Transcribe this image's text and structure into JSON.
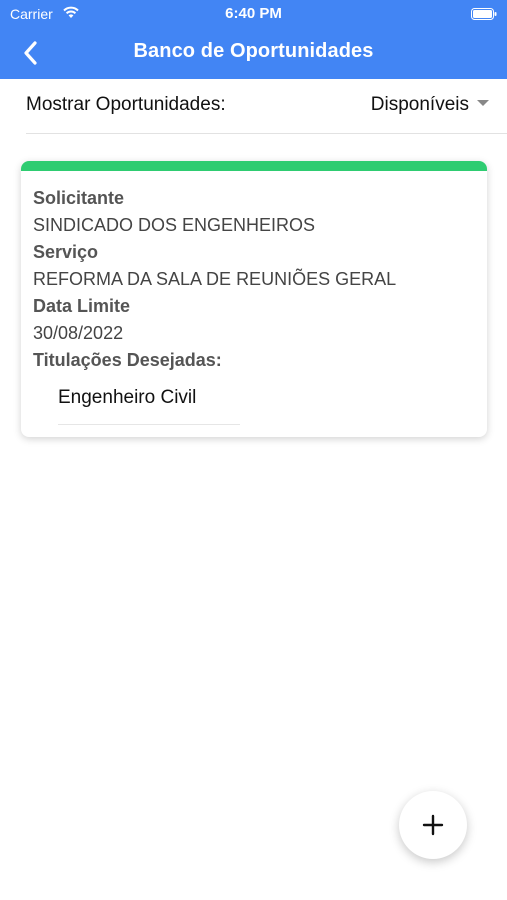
{
  "status_bar": {
    "carrier": "Carrier",
    "time": "6:40 PM"
  },
  "header": {
    "title": "Banco de Oportunidades",
    "background_color": "#4285f4",
    "back_icon": "chevron-left-icon"
  },
  "filter": {
    "label": "Mostrar Oportunidades:",
    "selected": "Disponíveis"
  },
  "card": {
    "accent_color": "#2ecc71",
    "solicitante_label": "Solicitante",
    "solicitante_value": "SINDICADO DOS ENGENHEIROS",
    "servico_label": "Serviço",
    "servico_value": "REFORMA DA SALA DE REUNIÕES GERAL",
    "data_limite_label": "Data Limite",
    "data_limite_value": "30/08/2022",
    "titulacoes_label": "Titulações Desejadas:",
    "titulacoes": [
      "Engenheiro Civil"
    ]
  },
  "fab": {
    "icon": "plus-icon"
  }
}
